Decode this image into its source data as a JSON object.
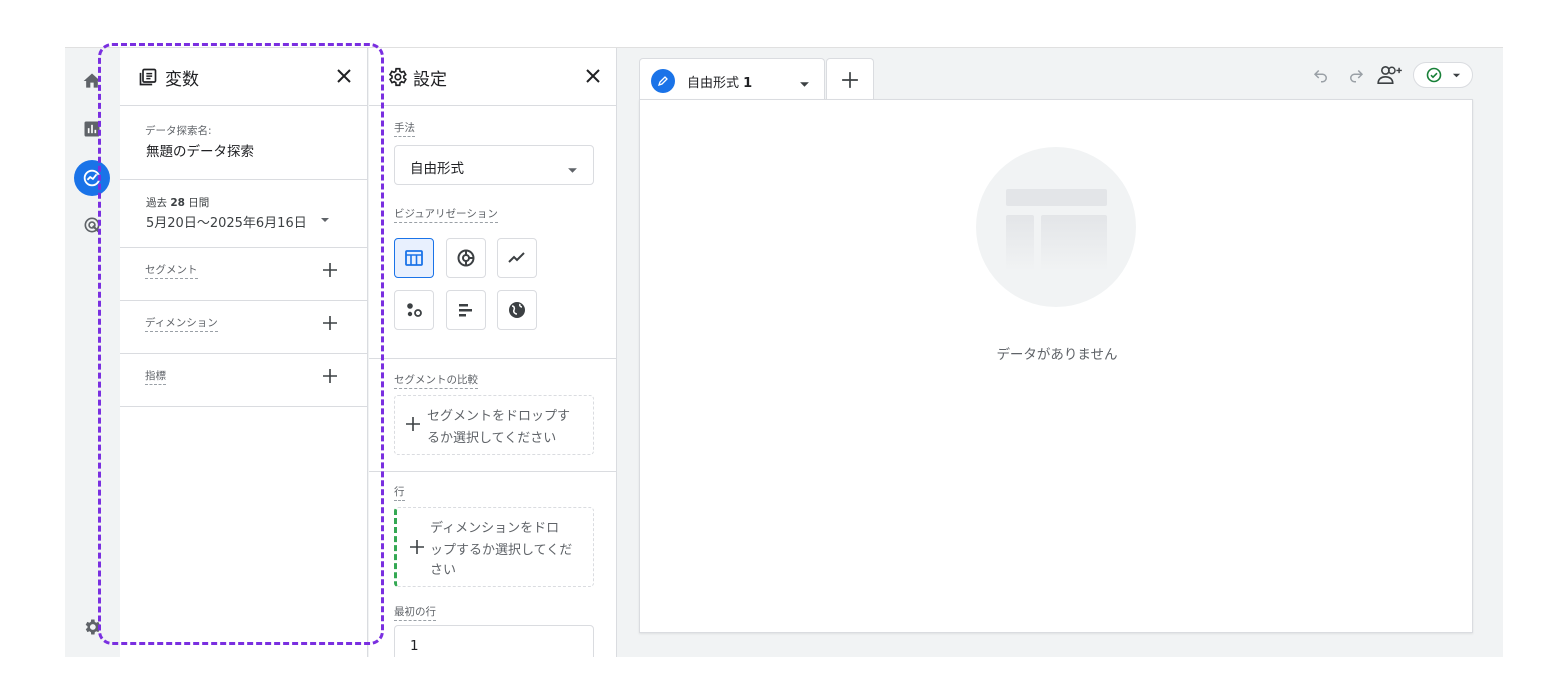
{
  "variables_panel": {
    "title": "変数",
    "exploration_name_label": "データ探索名:",
    "exploration_name": "無題のデータ探索",
    "date_preset_prefix": "過去 ",
    "date_preset_number": "28",
    "date_preset_suffix": " 日間",
    "date_range": "5月20日〜2025年6月16日",
    "sections": [
      {
        "label": "セグメント"
      },
      {
        "label": "ディメンション"
      },
      {
        "label": "指標"
      }
    ]
  },
  "settings_panel": {
    "title": "設定",
    "technique_label": "手法",
    "technique_value": "自由形式",
    "visualization_label": "ビジュアリゼーション",
    "segment_compare_label": "セグメントの比較",
    "segment_drop_text_line1": "セグメントをドロップす",
    "segment_drop_text_line2": "るか選択してください",
    "rows_label": "行",
    "rows_drop_line1": "ディメンションをドロ",
    "rows_drop_line2": "ップするか選択してくだ",
    "rows_drop_line3": "さい",
    "first_row_label": "最初の行",
    "first_row_value": "1"
  },
  "canvas": {
    "tab_label": "自由形式 ",
    "tab_number": "1",
    "empty_message": "データがありません"
  },
  "icons": {
    "rail": [
      "home-icon",
      "reports-icon",
      "explore-icon",
      "advertising-icon",
      "admin-gear-icon"
    ],
    "toolbar": [
      "undo-icon",
      "redo-icon",
      "share-user-icon",
      "check-circle-icon",
      "caret-down-icon"
    ]
  },
  "colors": {
    "accent": "#1a73e8",
    "highlight_outline": "#7a2fe0",
    "status_ok": "#188038",
    "row_drop_marker": "#34a853"
  }
}
